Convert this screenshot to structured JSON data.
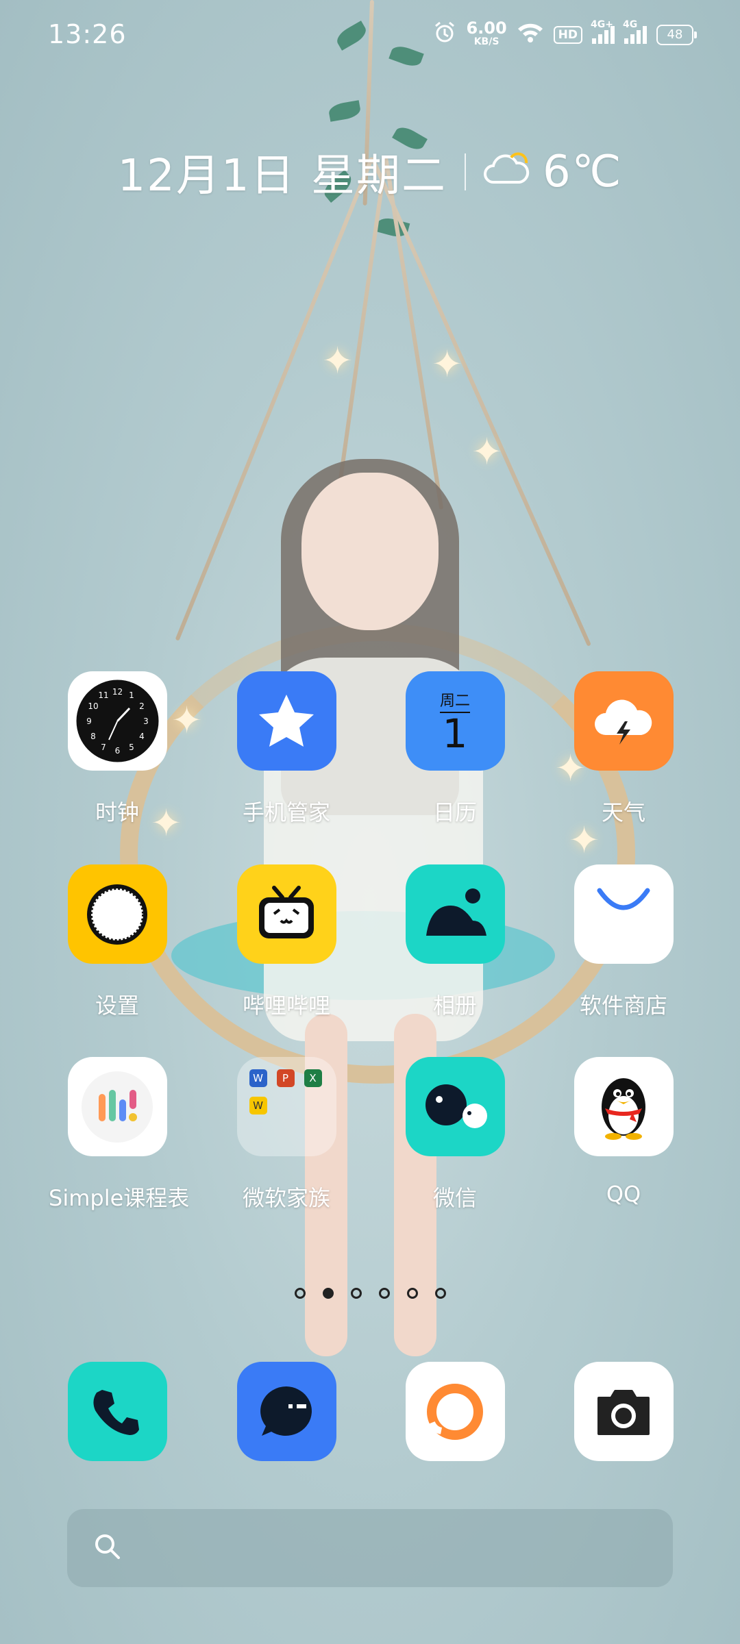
{
  "status_bar": {
    "time": "13:26",
    "speed_value": "6.00",
    "speed_unit": "KB/S",
    "hd_label": "HD",
    "network_1": "4G+",
    "network_2": "4G",
    "battery": "48",
    "icons": [
      "alarm-icon",
      "wifi-icon",
      "hd-icon",
      "signal-icon",
      "signal-icon",
      "battery-icon"
    ]
  },
  "header": {
    "date": "12月1日 星期二",
    "temperature": "6℃",
    "weather_icon": "partly-cloudy-icon"
  },
  "apps": [
    {
      "label": "时钟",
      "icon": "clock-icon"
    },
    {
      "label": "手机管家",
      "icon": "star-shield-icon"
    },
    {
      "label": "日历",
      "icon": "calendar-icon",
      "weekday": "周二",
      "day": "1"
    },
    {
      "label": "天气",
      "icon": "cloud-lightning-icon"
    },
    {
      "label": "设置",
      "icon": "gear-icon"
    },
    {
      "label": "哔哩哔哩",
      "icon": "bilibili-icon"
    },
    {
      "label": "相册",
      "icon": "gallery-icon"
    },
    {
      "label": "软件商店",
      "icon": "app-store-icon"
    },
    {
      "label": "Simple课程表",
      "icon": "timetable-icon"
    },
    {
      "label": "微软家族",
      "icon": "folder-icon",
      "folder_items": [
        "W",
        "P",
        "X",
        "W"
      ]
    },
    {
      "label": "微信",
      "icon": "wechat-icon"
    },
    {
      "label": "QQ",
      "icon": "qq-penguin-icon"
    }
  ],
  "page_indicator": {
    "count": 6,
    "active_index": 1
  },
  "dock": [
    {
      "icon": "phone-icon"
    },
    {
      "icon": "message-icon"
    },
    {
      "icon": "browser-icon"
    },
    {
      "icon": "camera-icon"
    }
  ],
  "search": {
    "icon": "search-icon"
  },
  "colors": {
    "wallpaper": "#b3cbcf",
    "orange": "#ff8a33",
    "blue": "#3a7bf6",
    "teal": "#1cd6c6",
    "yellow": "#ffcc00"
  }
}
